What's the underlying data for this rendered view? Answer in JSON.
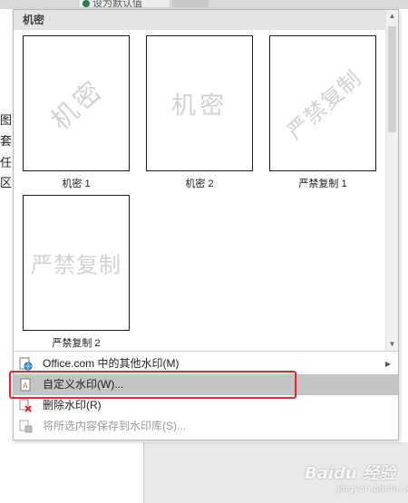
{
  "background": {
    "tab_label": "设为默认值",
    "doc_text": [
      "图",
      "套",
      "任",
      "区"
    ]
  },
  "gallery": {
    "header": "机密",
    "items": [
      {
        "watermark_text": "机密",
        "caption": "机密 1"
      },
      {
        "watermark_text": "机密",
        "caption": "机密 2"
      },
      {
        "watermark_text": "严禁复制",
        "caption": "严禁复制 1"
      },
      {
        "watermark_text": "严禁复制",
        "caption": "严禁复制 2"
      }
    ]
  },
  "menu": {
    "items": [
      {
        "label": "Office.com 中的其他水印(M)",
        "icon": "office-globe-icon"
      },
      {
        "label": "自定义水印(W)...",
        "icon": "custom-watermark-icon"
      },
      {
        "label": "删除水印(R)",
        "icon": "remove-watermark-icon"
      },
      {
        "label": "将所选内容保存到水印库(S)...",
        "icon": "save-to-gallery-icon"
      }
    ]
  },
  "overlay": {
    "brand": "Baidu 经验",
    "domain": "jingyan.baidu.com"
  },
  "colors": {
    "highlight": "#c4c4c4",
    "annotation": "#e8262a",
    "header_bg": "#e3e3e3"
  }
}
